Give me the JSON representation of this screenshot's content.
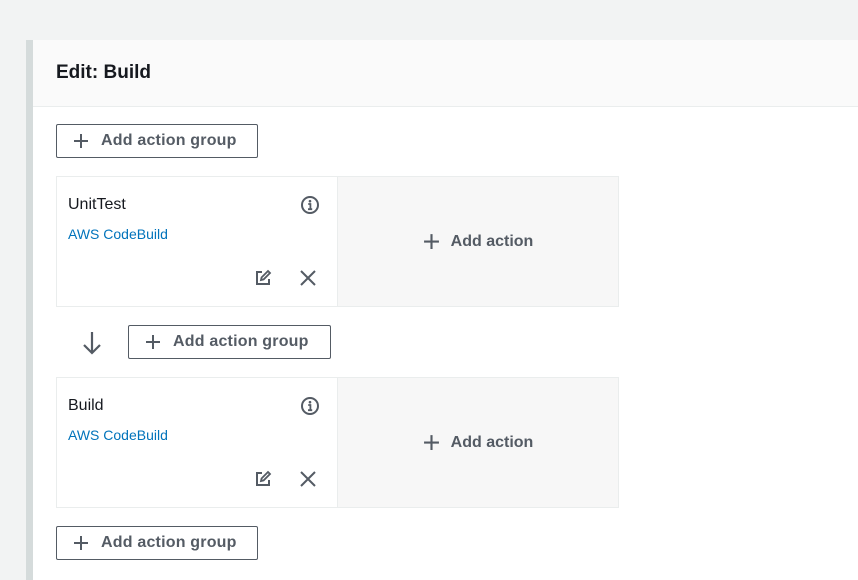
{
  "panel": {
    "title": "Edit: Build"
  },
  "buttons": {
    "add_action_group": "Add action group",
    "add_action": "Add action"
  },
  "action_groups": [
    {
      "name": "UnitTest",
      "provider": "AWS CodeBuild"
    },
    {
      "name": "Build",
      "provider": "AWS CodeBuild"
    }
  ],
  "icons": {
    "plus": "plus-icon",
    "info": "info-icon",
    "edit": "edit-icon",
    "close": "close-icon",
    "arrow": "arrow-down-icon"
  },
  "colors": {
    "link": "#0073bb",
    "button_text": "#545b64",
    "page_bg": "#f2f3f3"
  }
}
